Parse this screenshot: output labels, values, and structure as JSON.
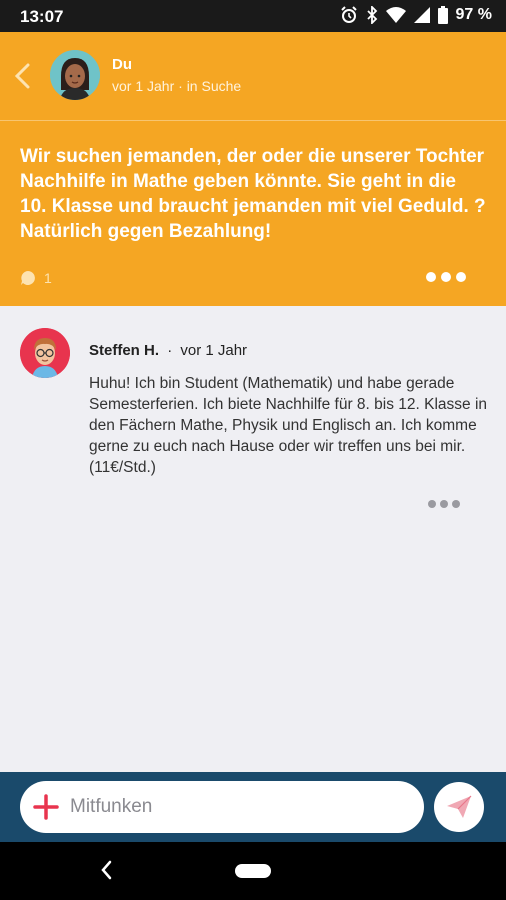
{
  "status_bar": {
    "time": "13:07",
    "battery": "97 %",
    "icons": [
      "alarm-icon",
      "bluetooth-icon",
      "wifi-icon",
      "signal-icon",
      "battery-icon"
    ]
  },
  "post": {
    "author_name": "Du",
    "meta": "vor 1 Jahr · in Suche",
    "text": "Wir suchen jemanden, der oder die unserer Tochter Nachhilfe in Mathe geben könnte. Sie geht in die 10. Klasse und braucht jemanden mit viel Geduld. ? Natürlich gegen Bezahlung!",
    "comment_count": "1",
    "background_color": "#f5a623"
  },
  "comment": {
    "author_name": "Steffen H.",
    "separator": "·",
    "time": "vor 1 Jahr",
    "text": "Huhu! Ich bin Student (Mathematik) und habe gerade Semesterferien. Ich biete Nachhilfe für 8. bis 12. Klasse in den Fächern Mathe, Physik und Englisch an. Ich komme gerne zu euch nach Hause oder wir treffen uns bei mir. (11€/Std.)"
  },
  "compose": {
    "placeholder": "Mitfunken",
    "accent_color": "#e8344e",
    "bar_color": "#1a4a6b"
  }
}
